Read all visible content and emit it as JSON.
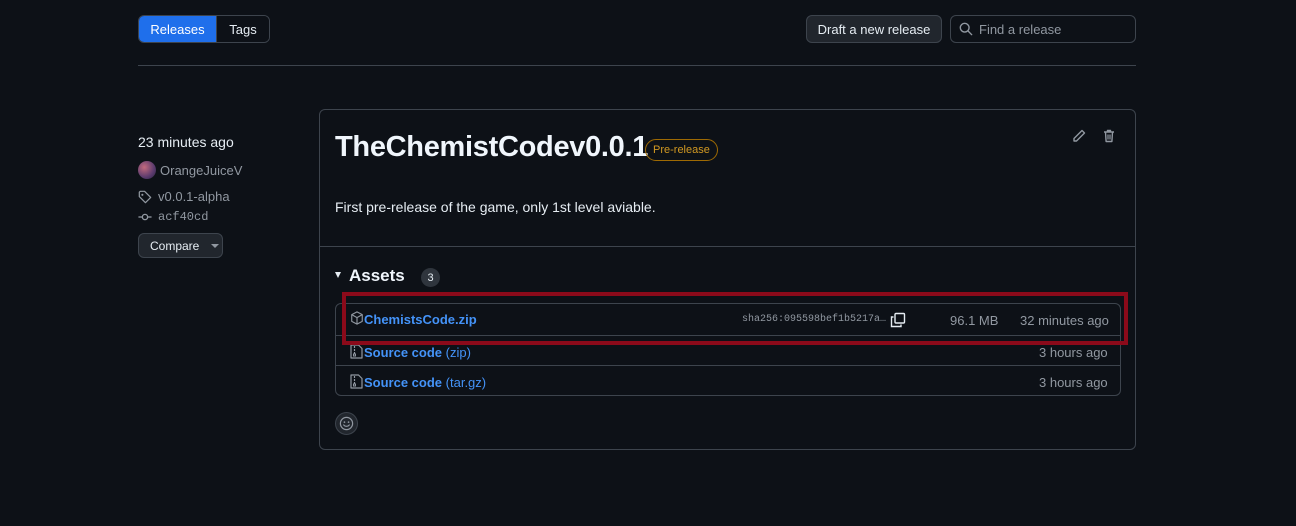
{
  "toolbar": {
    "releases_label": "Releases",
    "tags_label": "Tags",
    "draft_label": "Draft a new release",
    "search_placeholder": "Find a release"
  },
  "meta": {
    "time": "23 minutes ago",
    "author": "OrangeJuiceV",
    "tag": "v0.0.1-alpha",
    "commit": "acf40cd",
    "compare_label": "Compare"
  },
  "release": {
    "title": "TheChemistCodev0.0.1",
    "badge": "Pre-release",
    "description": "First pre-release of the game, only 1st level aviable."
  },
  "assets": {
    "title": "Assets",
    "count": "3",
    "items": [
      {
        "name": "ChemistsCode.zip",
        "sha": "sha256:095598bef1b5217a…",
        "size": "96.1 MB",
        "time": "32 minutes ago"
      },
      {
        "name": "Source code",
        "ext": "(zip)",
        "time": "3 hours ago"
      },
      {
        "name": "Source code",
        "ext": "(tar.gz)",
        "time": "3 hours ago"
      }
    ]
  },
  "colors": {
    "background": "#0d1117",
    "accent": "#1f6feb",
    "link": "#4493f8",
    "prerelease": "#d29922",
    "highlight": "#8b0a1a"
  },
  "icons": [
    "search-icon",
    "tag-icon",
    "commit-icon",
    "pencil-icon",
    "trash-icon",
    "package-icon",
    "file-zip-icon",
    "copy-icon",
    "smiley-icon"
  ]
}
